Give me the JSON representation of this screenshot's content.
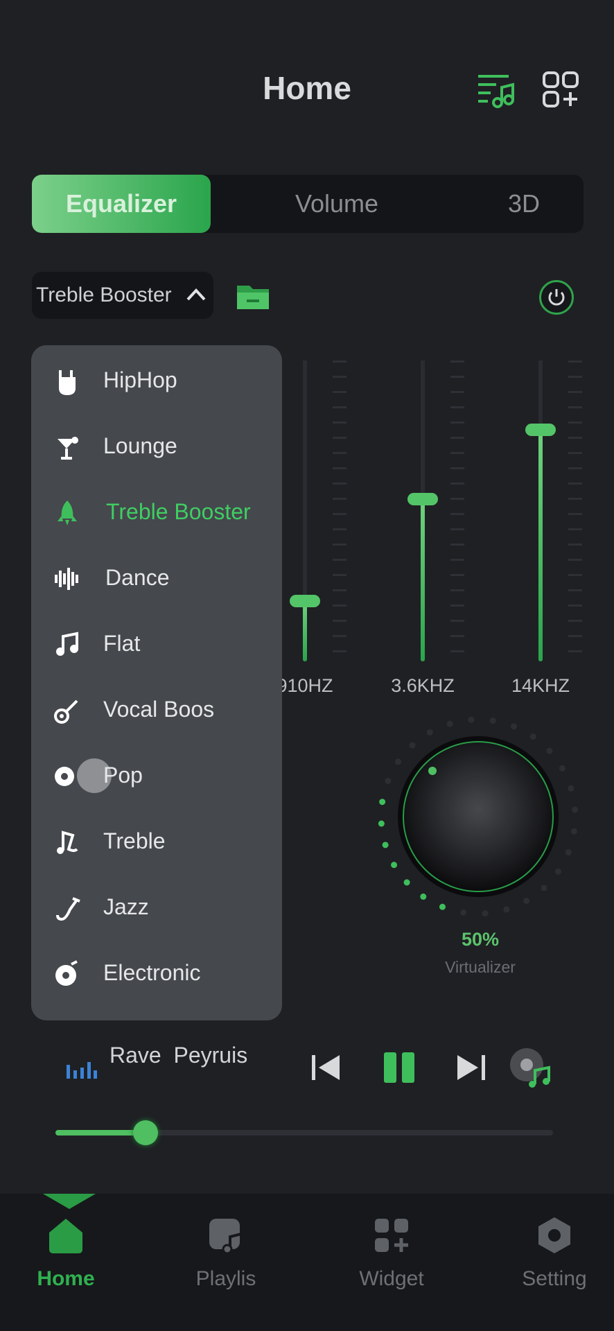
{
  "header": {
    "title": "Home",
    "icons": [
      "playlist-music-icon",
      "widgets-add-icon"
    ]
  },
  "tabs": [
    {
      "label": "Equalizer",
      "active": true
    },
    {
      "label": "Volume",
      "active": false
    },
    {
      "label": "3D",
      "active": false
    }
  ],
  "preset": {
    "selected": "Treble Booster",
    "open": true
  },
  "dropdown": {
    "items": [
      {
        "label": "HipHop",
        "icon": "rock-hand-icon",
        "selected": false
      },
      {
        "label": "Lounge",
        "icon": "cocktail-icon",
        "selected": false
      },
      {
        "label": "Treble Booster",
        "icon": "rocket-icon",
        "selected": true
      },
      {
        "label": "Dance",
        "icon": "waveform-icon",
        "selected": false
      },
      {
        "label": "Flat",
        "icon": "music-note-icon",
        "selected": false
      },
      {
        "label": "Vocal Boos",
        "icon": "guitar-icon",
        "selected": false
      },
      {
        "label": "Pop",
        "icon": "record-icon",
        "selected": false
      },
      {
        "label": "Treble",
        "icon": "treble-clef-icon",
        "selected": false
      },
      {
        "label": "Jazz",
        "icon": "saxophone-icon",
        "selected": false
      },
      {
        "label": "Electronic",
        "icon": "disc-icon",
        "selected": false
      }
    ]
  },
  "equalizer": {
    "bands": [
      {
        "label": "910HZ",
        "level": 0.2
      },
      {
        "label": "3.6KHZ",
        "level": 0.54
      },
      {
        "label": "14KHZ",
        "level": 0.77
      }
    ]
  },
  "virtualizer": {
    "value": "50%",
    "label": "Virtualizer",
    "level": 0.5
  },
  "player": {
    "title": "Rave  Peyruis",
    "progress": 0.15,
    "icons": [
      "equalizer-bars-icon",
      "previous-icon",
      "pause-icon",
      "next-icon",
      "vinyl-music-icon"
    ]
  },
  "nav": [
    {
      "label": "Home",
      "icon": "home-icon",
      "active": true
    },
    {
      "label": "Playlis",
      "icon": "playlist-icon",
      "active": false
    },
    {
      "label": "Widget",
      "icon": "widget-icon",
      "active": false
    },
    {
      "label": "Setting",
      "icon": "hexagon-settings-icon",
      "active": false
    }
  ],
  "colors": {
    "accent": "#4fbf61",
    "background": "#1f2024",
    "dropdown": "#45484d"
  }
}
